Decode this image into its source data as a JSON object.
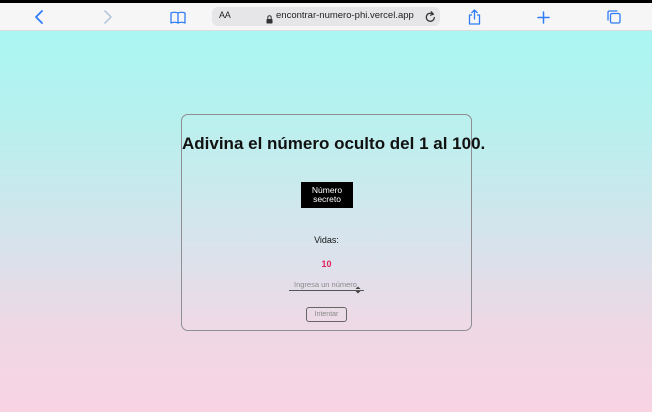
{
  "browser": {
    "reader_label": "AA",
    "url": "encontrar-numero-phi.vercel.app",
    "icons": {
      "back": "chevron-left-icon",
      "forward": "chevron-right-icon",
      "bookmarks": "book-icon",
      "lock": "lock-icon",
      "reload": "reload-icon",
      "share": "share-icon",
      "new_tab": "plus-icon",
      "tabs": "tabs-icon"
    },
    "accent": "#2f7cf6"
  },
  "game": {
    "title": "Adivina el número oculto del 1 al 100.",
    "secret_label": "Número secreto",
    "lives_label": "Vidas:",
    "lives_value": "10",
    "lives_color": "#e0245e",
    "input_placeholder": "Ingresa un número",
    "try_button": "Intentar"
  }
}
